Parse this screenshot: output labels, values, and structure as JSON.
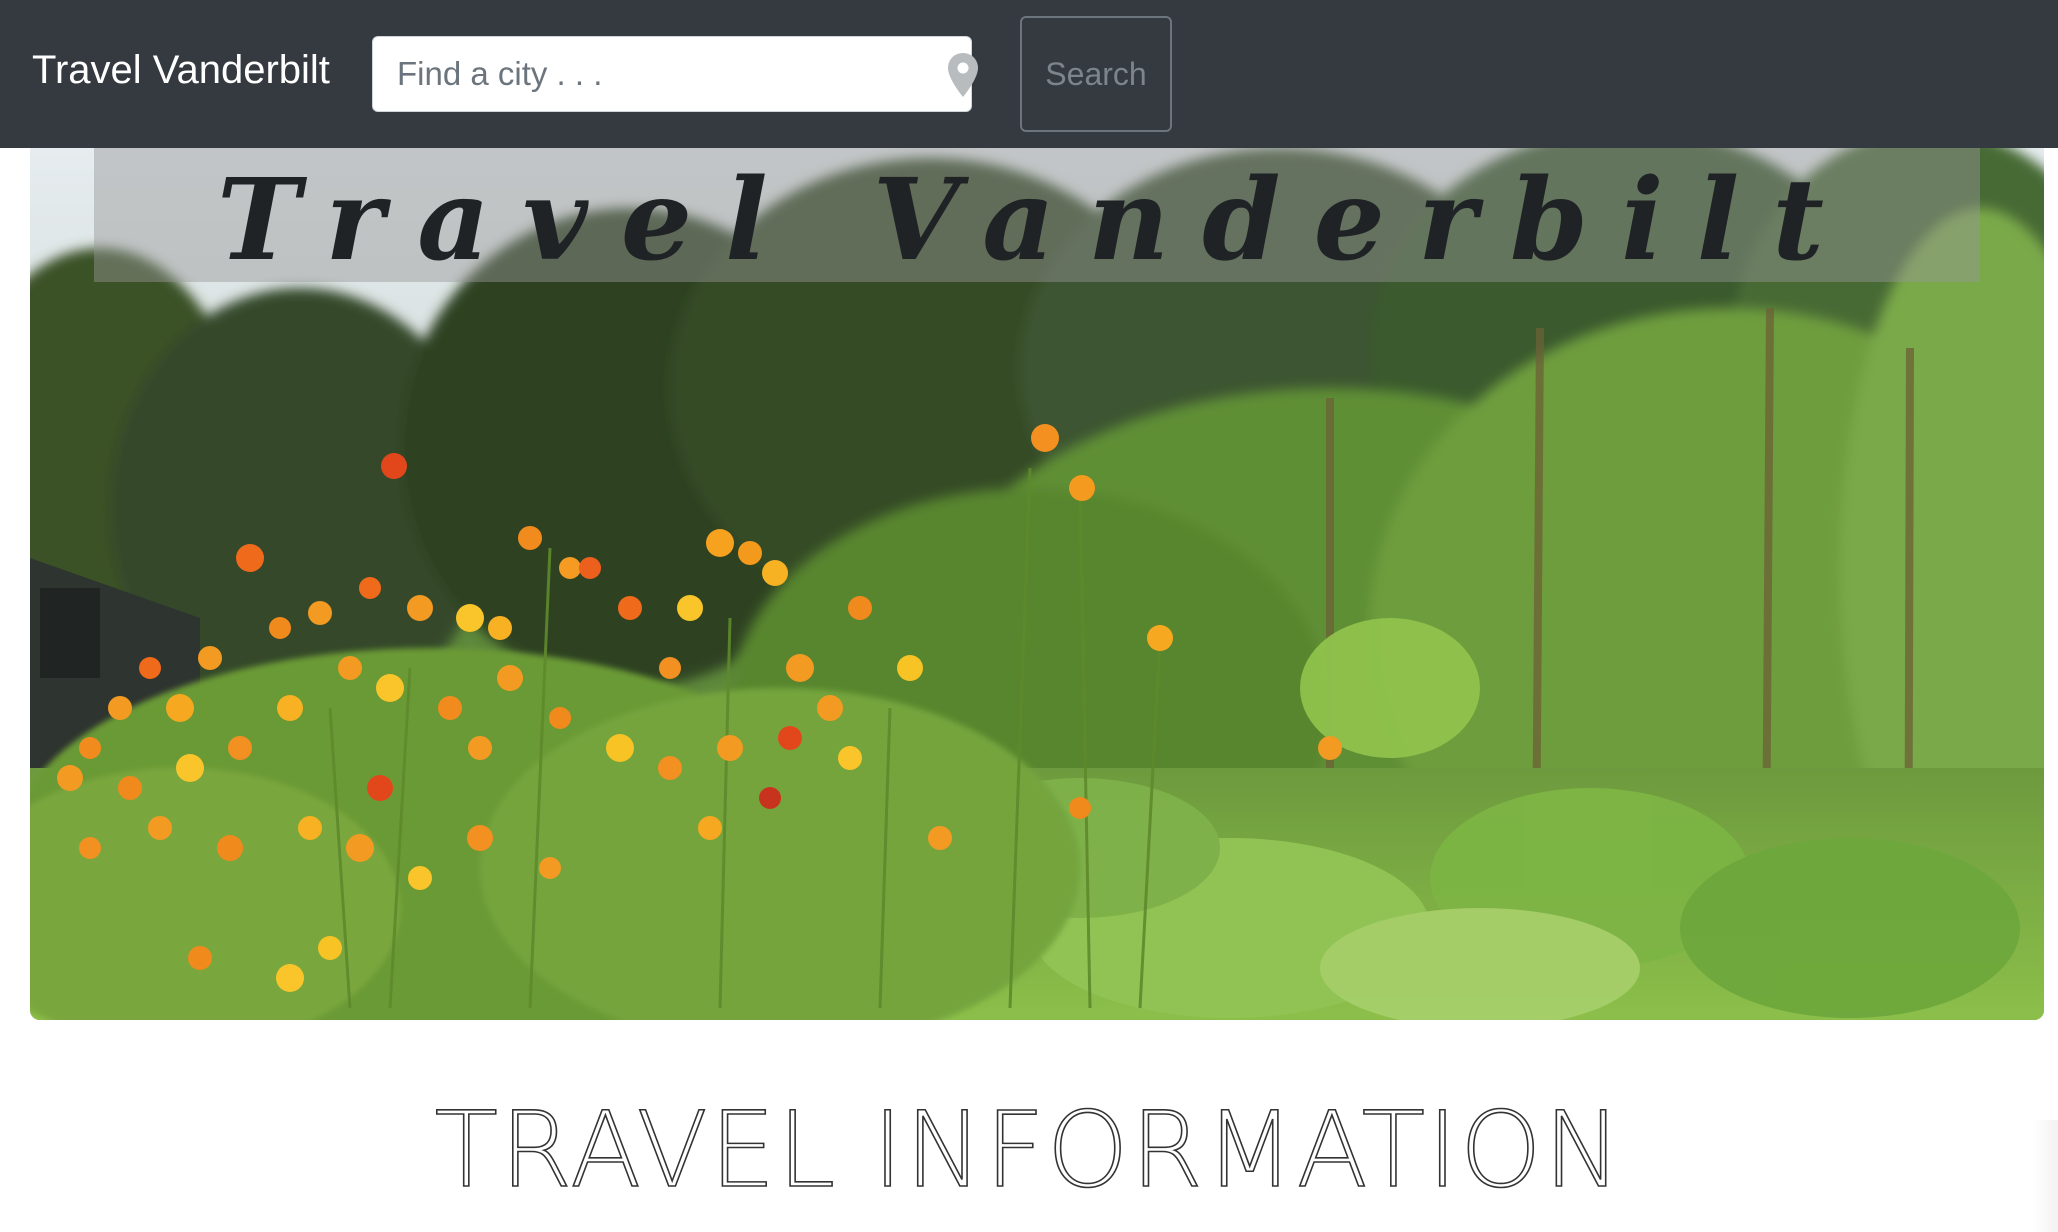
{
  "navbar": {
    "brand": "Travel Vanderbilt",
    "search": {
      "placeholder": "Find a city . . .",
      "value": "",
      "location_icon": "map-pin-icon"
    },
    "search_button_label": "Search"
  },
  "hero": {
    "title": "Travel Vanderbilt",
    "image_subject": "garden with orange cosmos flowers and tall green plants"
  },
  "section": {
    "heading": "TRAVEL INFORMATION"
  },
  "colors": {
    "navbar_bg": "#343a40",
    "brand_text": "#ffffff",
    "title_text": "#1f2326",
    "heading_outline": "#333333"
  }
}
